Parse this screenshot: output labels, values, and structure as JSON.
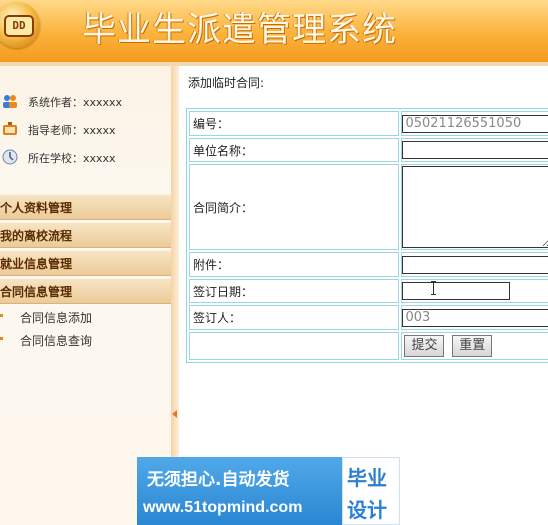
{
  "header": {
    "system_title": "毕业生派遣管理系统",
    "logo_text": "DD"
  },
  "sidebar": {
    "info": [
      {
        "label": "系统作者：",
        "value": "xxxxxx",
        "icon": "users-icon"
      },
      {
        "label": "指导老师：",
        "value": "xxxxx",
        "icon": "teacher-icon"
      },
      {
        "label": "所在学校：",
        "value": "xxxxx",
        "icon": "school-icon"
      }
    ],
    "menu": [
      {
        "label": "个人资料管理"
      },
      {
        "label": "我的离校流程"
      },
      {
        "label": "就业信息管理"
      },
      {
        "label": "合同信息管理"
      }
    ],
    "submenu": [
      {
        "label": "合同信息添加"
      },
      {
        "label": "合同信息查询"
      }
    ]
  },
  "content": {
    "title": "添加临时合同:",
    "form": {
      "number_label": "编号：",
      "number_value": "05021126551050",
      "company_label": "单位名称：",
      "summary_label": "合同简介：",
      "attachment_label": "附件：",
      "date_label": "签订日期：",
      "signer_label": "签订人：",
      "signer_value": "003",
      "submit_label": "提交",
      "reset_label": "重置"
    }
  },
  "watermark": {
    "line1": "无须担心.自动发货",
    "line2": "www.51topmind.com",
    "side1": "毕业",
    "side2": "设计"
  },
  "colors": {
    "header": "#f7a52c",
    "menu_bar": "#eccb98",
    "table_border": "#8fd6e0",
    "watermark": "#2b86d3"
  }
}
